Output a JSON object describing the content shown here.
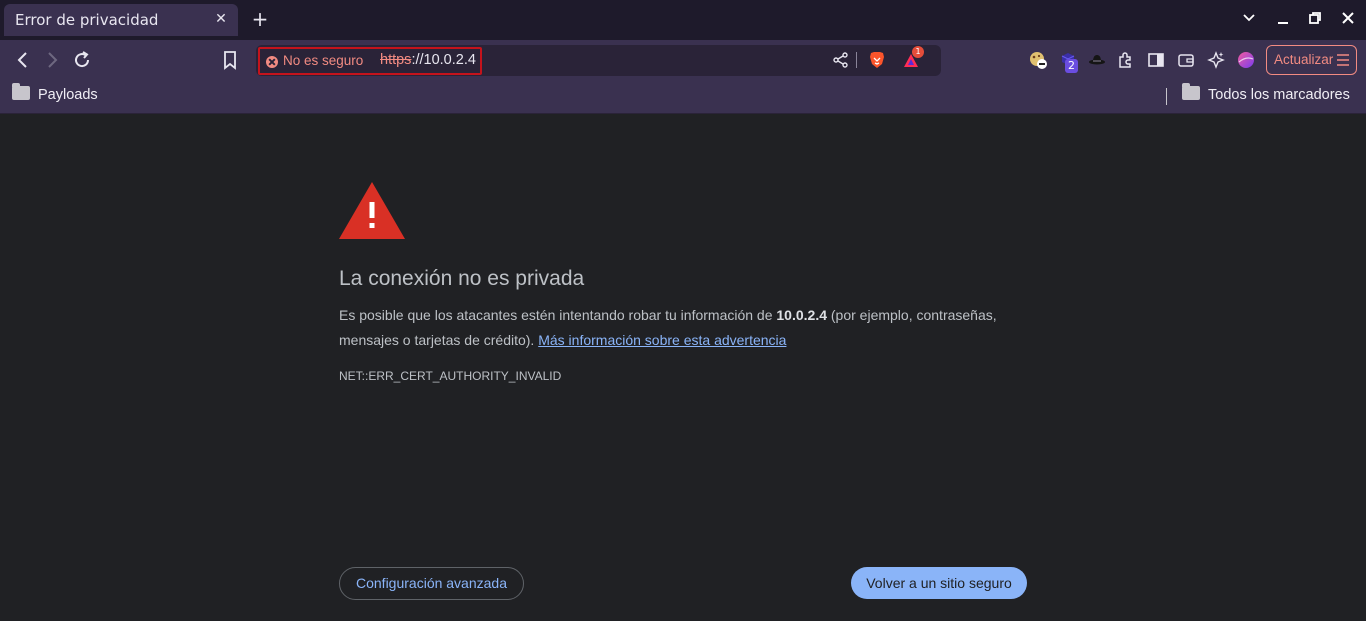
{
  "tab": {
    "title": "Error de privacidad",
    "close": "✕"
  },
  "newtab": "+",
  "window": {
    "chevron": "⌄",
    "minimize": "—",
    "restore": "⧉",
    "close": "✕"
  },
  "omnibox": {
    "security_label": "No es seguro",
    "url_scheme": "https",
    "url_rest": "://10.0.2.4"
  },
  "extensions": {
    "badge_count": "2",
    "alert_badge": "1"
  },
  "update_button": {
    "label": "Actualizar"
  },
  "bookmarks": {
    "left": "Payloads",
    "right": "Todos los marcadores"
  },
  "interstitial": {
    "heading": "La conexión no es privada",
    "desc_before": "Es posible que los atacantes estén intentando robar tu información de ",
    "desc_host": "10.0.2.4",
    "desc_after": " (por ejemplo, contraseñas, mensajes o tarjetas de crédito). ",
    "learn_more": "Más información sobre esta advertencia",
    "error_code": "NET::ERR_CERT_AUTHORITY_INVALID",
    "advanced_button": "Configuración avanzada",
    "back_button": "Volver a un sitio seguro"
  },
  "colors": {
    "chrome_bg": "#3a3150",
    "page_bg": "#202124",
    "warning_red": "#d93025",
    "link_blue": "#8ab4f8",
    "insecure_red": "#f28b82"
  }
}
